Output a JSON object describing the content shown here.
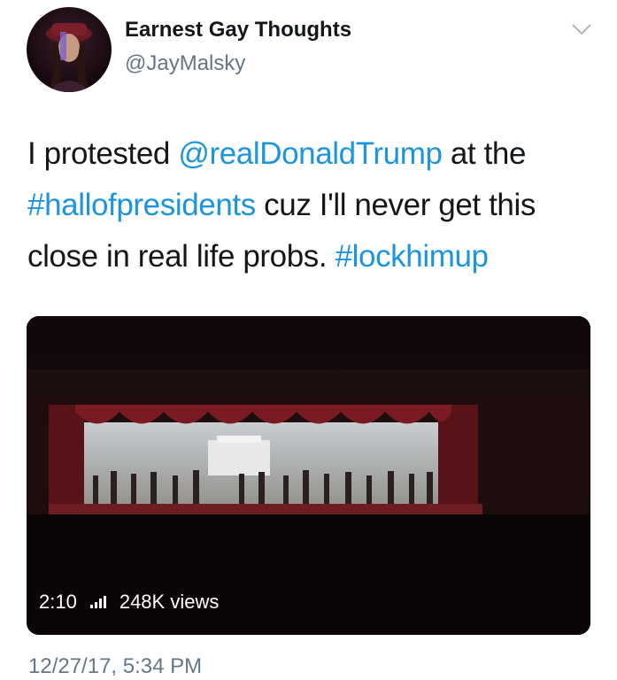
{
  "tweet": {
    "author": {
      "display_name": "Earnest Gay Thoughts",
      "handle": "@JayMalsky",
      "avatar_icon": "profile-photo"
    },
    "menu_icon": "chevron-down-icon",
    "text_segments": [
      {
        "text": "I protested ",
        "link": false
      },
      {
        "text": "@realDonaldTrump",
        "link": true
      },
      {
        "text": " at the ",
        "link": false
      },
      {
        "text": "#hallofpresidents",
        "link": true
      },
      {
        "text": " cuz I'll never get this close in real life probs. ",
        "link": false
      },
      {
        "text": "#lockhimup",
        "link": true
      }
    ],
    "video": {
      "duration": "2:10",
      "views": "248K views",
      "signal_icon": "signal-bars-icon"
    },
    "timestamp": "12/27/17, 5:34 PM"
  },
  "colors": {
    "link": "#1b95e0",
    "text": "#14171a",
    "secondary": "#657786"
  }
}
